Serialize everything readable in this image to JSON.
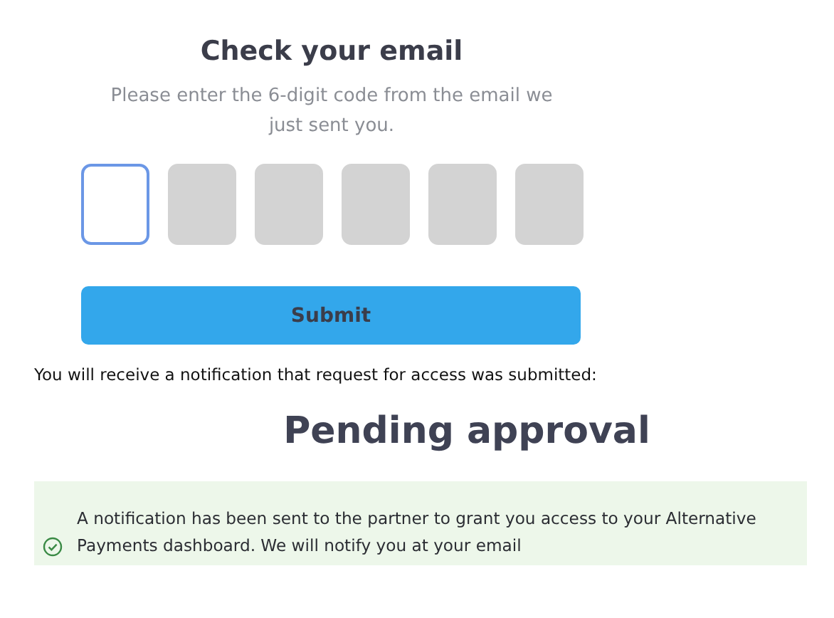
{
  "verify": {
    "title": "Check your email",
    "subtitle": "Please enter the 6-digit code from the email we just sent you.",
    "code_boxes": [
      {
        "focused": true
      },
      {
        "focused": false
      },
      {
        "focused": false
      },
      {
        "focused": false
      },
      {
        "focused": false
      },
      {
        "focused": false
      }
    ],
    "submit_button": "Submit"
  },
  "notice": "You will receive a notification that request for access was submitted:",
  "status": {
    "title": "Pending approval",
    "message": "A notification has been sent to the partner to grant you access to your Alternative Payments dashboard. We will notify you at your email"
  }
}
